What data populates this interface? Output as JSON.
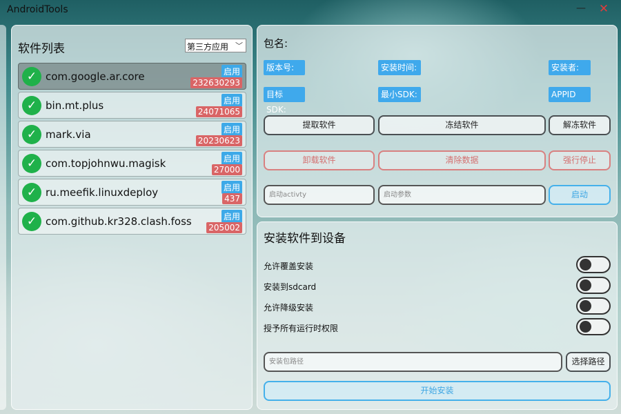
{
  "window": {
    "title": "AndroidTools",
    "minimize_glyph": "—",
    "close_glyph": "✕"
  },
  "app_list": {
    "title": "软件列表",
    "filter_selected": "第三方应用",
    "items": [
      {
        "name": "com.google.ar.core",
        "status": "启用",
        "version": "232630293",
        "selected": true
      },
      {
        "name": "bin.mt.plus",
        "status": "启用",
        "version": "24071065",
        "selected": false
      },
      {
        "name": "mark.via",
        "status": "启用",
        "version": "20230623",
        "selected": false
      },
      {
        "name": "com.topjohnwu.magisk",
        "status": "启用",
        "version": "27000",
        "selected": false
      },
      {
        "name": "ru.meefik.linuxdeploy",
        "status": "启用",
        "version": "437",
        "selected": false
      },
      {
        "name": "com.github.kr328.clash.foss",
        "status": "启用",
        "version": "205002",
        "selected": false
      }
    ]
  },
  "app_info": {
    "package_label": "包名:",
    "version_chip": "版本号:",
    "install_time_chip": "安装时间:",
    "installer_chip": "安装者:",
    "target_sdk_chip": "目标SDK:",
    "min_sdk_chip": "最小SDK:",
    "appid_chip": "APPID",
    "extract_button": "提取软件",
    "freeze_button": "冻结软件",
    "unfreeze_button": "解冻软件",
    "uninstall_button": "卸载软件",
    "clear_data_button": "清除数据",
    "force_stop_button": "强行停止",
    "activity_placeholder": "启动activty",
    "params_placeholder": "启动参数",
    "launch_button": "启动"
  },
  "install": {
    "title": "安装软件到设备",
    "options": [
      {
        "label": "允许覆盖安装",
        "enabled": false
      },
      {
        "label": "安装到sdcard",
        "enabled": false
      },
      {
        "label": "允许降级安装",
        "enabled": false
      },
      {
        "label": "授予所有运行时权限",
        "enabled": false
      }
    ],
    "path_placeholder": "安装包路径",
    "choose_path_button": "选择路径",
    "start_button": "开始安装"
  },
  "colors": {
    "status_badge": "#3da9e8",
    "version_badge": "#d96566",
    "check": "#1fb14a",
    "info_chip": "#3fa9ec",
    "danger": "#d98080",
    "primary": "#45b0ea",
    "close": "#e03c3c"
  },
  "icons": [
    "check-circle-icon",
    "chevron-down-icon",
    "minimize-icon",
    "close-icon"
  ]
}
